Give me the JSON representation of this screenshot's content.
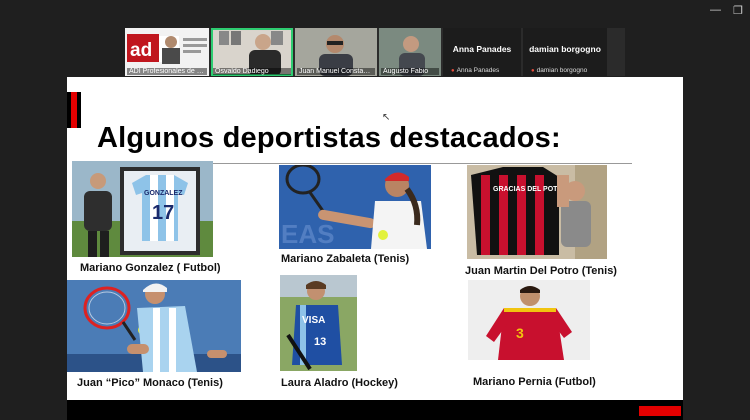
{
  "participants": [
    {
      "name": "ADI Profesionales de la Industria"
    },
    {
      "name": "Osvaldo Dadiego"
    },
    {
      "name": "Juan Manuel Constantin"
    },
    {
      "name": "Augusto Fabio"
    },
    {
      "name": "Anna Panades",
      "label": "Anna Panades"
    },
    {
      "name": "damian borgogno",
      "label": "damian borgogno"
    }
  ],
  "slide": {
    "title": "Algunos deportistas destacados:",
    "athletes": [
      {
        "caption": "Mariano Gonzalez ( Futbol)",
        "jersey_number": "17",
        "jersey_text": "GONZALEZ"
      },
      {
        "caption": "Mariano Zabaleta (Tenis)"
      },
      {
        "caption": "Juan Martin Del Potro (Tenis)",
        "shirt_text": "GRACIAS DEL POTRO"
      },
      {
        "caption": "Juan “Pico” Monaco (Tenis)"
      },
      {
        "caption": "Laura Aladro (Hockey)",
        "jersey_text": "VISA",
        "jersey_number": "13"
      },
      {
        "caption": "Mariano Pernia (Futbol)",
        "jersey_number": "3"
      }
    ]
  },
  "colors": {
    "accent_red": "#e30000",
    "active_speaker": "#2ecc71"
  }
}
